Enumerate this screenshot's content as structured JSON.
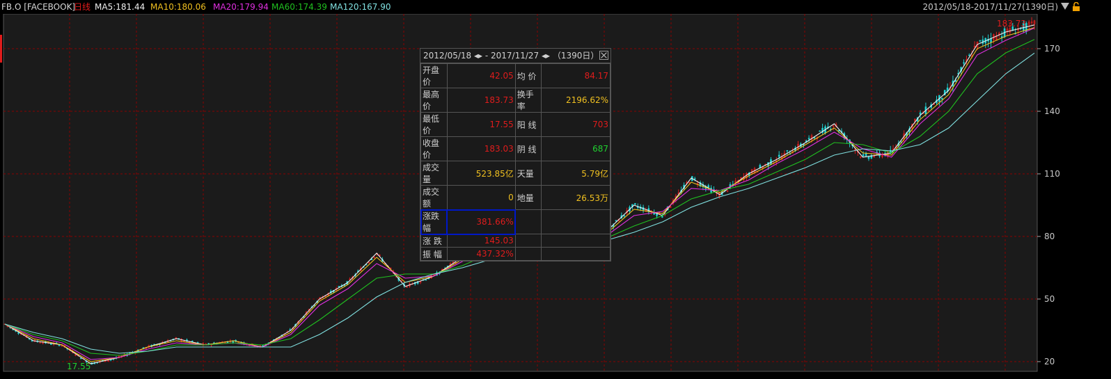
{
  "header": {
    "symbol": "FB.O [FACEBOOK]",
    "period": "日线",
    "ma5": "MA5:181.44",
    "ma10": "MA10:180.06",
    "ma20": "MA20:179.94",
    "ma60": "MA60:174.39",
    "ma120": "MA120:167.90",
    "range": "2012/05/18-2017/11/27(1390日)"
  },
  "colors": {
    "up": "#e01c1c",
    "down": "#20d0d0",
    "ma5": "#f0f0f0",
    "ma10": "#f0c020",
    "ma20": "#e030e0",
    "ma60": "#20c020",
    "ma120": "#80e0e0",
    "grid": "#8b0000"
  },
  "stats": {
    "title": "2012/05/18 ◂▸ - 2017/11/27 ◂▸ （1390日）",
    "rows": [
      {
        "k1": "开盘价",
        "v1": "42.05",
        "c1": "red",
        "k2": "均 价",
        "v2": "84.17",
        "c2": "red"
      },
      {
        "k1": "最高价",
        "v1": "183.73",
        "c1": "red",
        "k2": "换手率",
        "v2": "2196.62%",
        "c2": "yellow"
      },
      {
        "k1": "最低价",
        "v1": "17.55",
        "c1": "red",
        "k2": "阳 线",
        "v2": "703",
        "c2": "red"
      },
      {
        "k1": "收盘价",
        "v1": "183.03",
        "c1": "red",
        "k2": "阴 线",
        "v2": "687",
        "c2": "green"
      },
      {
        "k1": "成交量",
        "v1": "523.85亿",
        "c1": "yellow",
        "k2": "天量",
        "v2": "5.79亿",
        "c2": "yellow"
      },
      {
        "k1": "成交额",
        "v1": "0",
        "c1": "yellow",
        "k2": "地量",
        "v2": "26.53万",
        "c2": "yellow"
      },
      {
        "k1": "涨跌幅",
        "v1": "381.66%",
        "c1": "red",
        "k2": "",
        "v2": "",
        "c2": "red"
      },
      {
        "k1": "涨 跌",
        "v1": "145.03",
        "c1": "red",
        "k2": "",
        "v2": "",
        "c2": "red"
      },
      {
        "k1": "振 幅",
        "v1": "437.32%",
        "c1": "red",
        "k2": "",
        "v2": "",
        "c2": "red"
      }
    ]
  },
  "chart_data": {
    "type": "line",
    "yticks": [
      20,
      50,
      80,
      110,
      140,
      170
    ],
    "ylim": [
      17,
      184
    ],
    "high_label": "183.73",
    "low_label": "17.55",
    "x_range": [
      "2012/05/18",
      "2017/11/27"
    ],
    "grid": true,
    "series": [
      {
        "name": "MA5",
        "values": [
          38,
          30,
          28,
          19,
          22,
          27,
          31,
          28,
          30,
          27,
          35,
          50,
          58,
          72,
          56,
          61,
          70,
          77,
          78,
          78,
          79,
          82,
          95,
          90,
          108,
          100,
          110,
          117,
          125,
          134,
          118,
          120,
          138,
          150,
          172,
          178,
          181.4
        ]
      },
      {
        "name": "MA10",
        "values": [
          38,
          31,
          28,
          20,
          22,
          27,
          30,
          28,
          30,
          27,
          34,
          49,
          57,
          70,
          58,
          61,
          69,
          76,
          77,
          78,
          79,
          81,
          93,
          91,
          106,
          101,
          109,
          116,
          124,
          132,
          120,
          119,
          136,
          148,
          170,
          176,
          180.1
        ]
      },
      {
        "name": "MA20",
        "values": [
          38,
          32,
          29,
          21,
          22,
          26,
          29,
          28,
          29,
          27,
          33,
          47,
          55,
          67,
          60,
          61,
          68,
          75,
          76,
          77,
          78,
          80,
          90,
          92,
          103,
          102,
          107,
          115,
          122,
          130,
          122,
          118,
          134,
          146,
          167,
          174,
          179.9
        ]
      },
      {
        "name": "MA60",
        "values": [
          38,
          33,
          30,
          24,
          23,
          25,
          28,
          28,
          29,
          28,
          31,
          40,
          50,
          60,
          62,
          62,
          66,
          72,
          75,
          76,
          77,
          79,
          85,
          90,
          98,
          102,
          105,
          111,
          117,
          125,
          124,
          120,
          128,
          140,
          158,
          168,
          174.4
        ]
      },
      {
        "name": "MA120",
        "values": [
          38,
          34,
          31,
          26,
          24,
          25,
          27,
          27,
          27,
          27,
          27,
          33,
          41,
          51,
          58,
          62,
          65,
          69,
          72,
          74,
          76,
          78,
          82,
          87,
          94,
          99,
          103,
          108,
          113,
          119,
          122,
          121,
          124,
          132,
          145,
          158,
          167.9
        ]
      }
    ]
  }
}
